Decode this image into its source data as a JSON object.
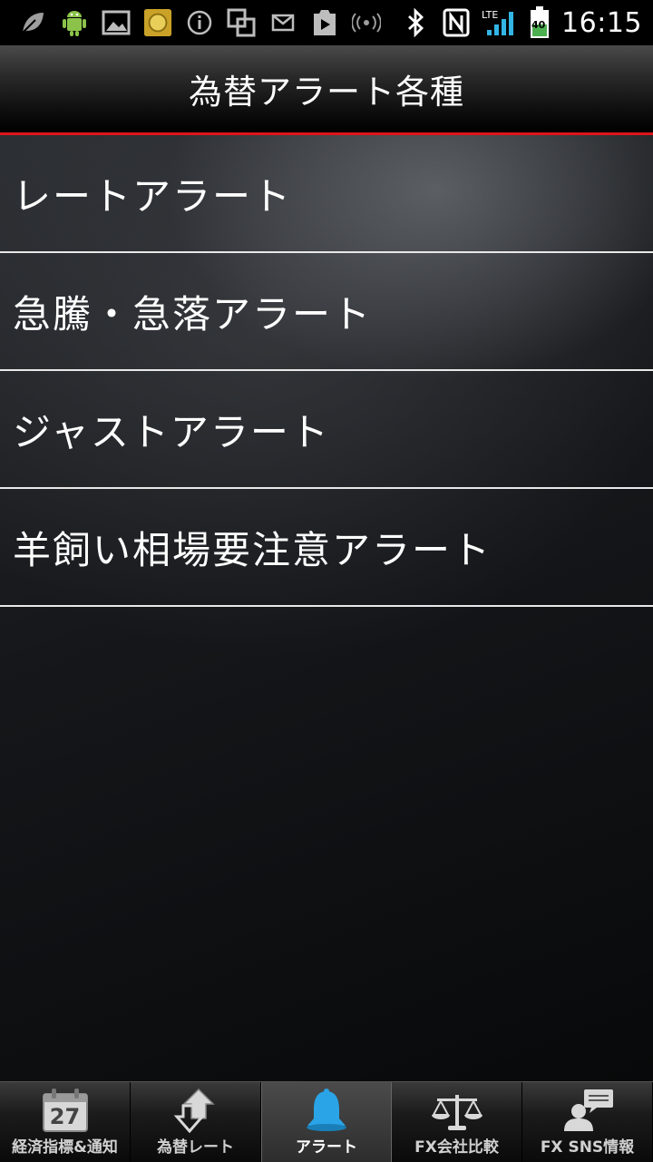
{
  "status_bar": {
    "time": "16:15",
    "network": "LTE",
    "battery_level": "40"
  },
  "header": {
    "title": "為替アラート各種"
  },
  "menu": {
    "items": [
      {
        "label": "レートアラート"
      },
      {
        "label": "急騰・急落アラート"
      },
      {
        "label": "ジャストアラート"
      },
      {
        "label": "羊飼い相場要注意アラート"
      }
    ]
  },
  "tabs": {
    "calendar_day": "27",
    "items": [
      {
        "label": "経済指標&通知",
        "icon": "calendar-icon"
      },
      {
        "label": "為替レート",
        "icon": "exchange-arrows-icon"
      },
      {
        "label": "アラート",
        "icon": "bell-icon",
        "active": true
      },
      {
        "label": "FX会社比較",
        "icon": "scale-icon"
      },
      {
        "label": "FX SNS情報",
        "icon": "sns-chat-icon"
      }
    ]
  },
  "colors": {
    "accent_line": "#e0141a",
    "bell_blue": "#2aa4e6"
  }
}
